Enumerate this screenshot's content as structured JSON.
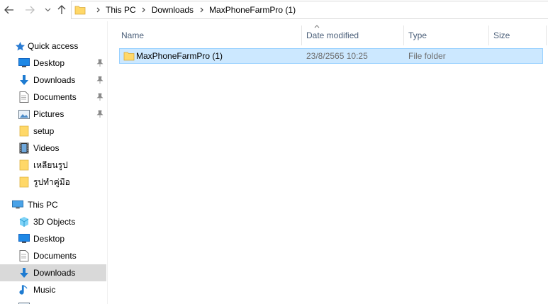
{
  "navigation": {
    "breadcrumbs": [
      "This PC",
      "Downloads",
      "MaxPhoneFarmPro (1)"
    ]
  },
  "sidebar": {
    "quick_access": {
      "label": "Quick access",
      "items": [
        {
          "label": "Desktop",
          "icon": "desktop-icon",
          "pinned": true
        },
        {
          "label": "Downloads",
          "icon": "download-arrow-icon",
          "pinned": true
        },
        {
          "label": "Documents",
          "icon": "document-icon",
          "pinned": true
        },
        {
          "label": "Pictures",
          "icon": "pictures-icon",
          "pinned": true
        },
        {
          "label": "setup",
          "icon": "folder-icon",
          "pinned": false
        },
        {
          "label": "Videos",
          "icon": "film-icon",
          "pinned": false
        },
        {
          "label": "เหลียนรูป",
          "icon": "folder-icon",
          "pinned": false
        },
        {
          "label": "รูปทำคู่มือ",
          "icon": "folder-icon",
          "pinned": false
        }
      ]
    },
    "this_pc": {
      "label": "This PC",
      "items": [
        {
          "label": "3D Objects",
          "icon": "cube-icon"
        },
        {
          "label": "Desktop",
          "icon": "desktop-icon"
        },
        {
          "label": "Documents",
          "icon": "document-icon"
        },
        {
          "label": "Downloads",
          "icon": "download-arrow-icon",
          "selected": true
        },
        {
          "label": "Music",
          "icon": "music-note-icon"
        }
      ]
    }
  },
  "file_list": {
    "columns": [
      "Name",
      "Date modified",
      "Type",
      "Size"
    ],
    "sort_column": "Name",
    "rows": [
      {
        "name": "MaxPhoneFarmPro (1)",
        "date_modified": "23/8/2565 10:25",
        "type": "File folder",
        "size": "",
        "selected": true
      }
    ]
  },
  "colors": {
    "selection_bg": "#cce8ff",
    "selection_border": "#99d1ff",
    "sidebar_selected": "#d9d9d9",
    "folder_yellow": "#ffd868",
    "accent_blue": "#1e7bd1"
  }
}
